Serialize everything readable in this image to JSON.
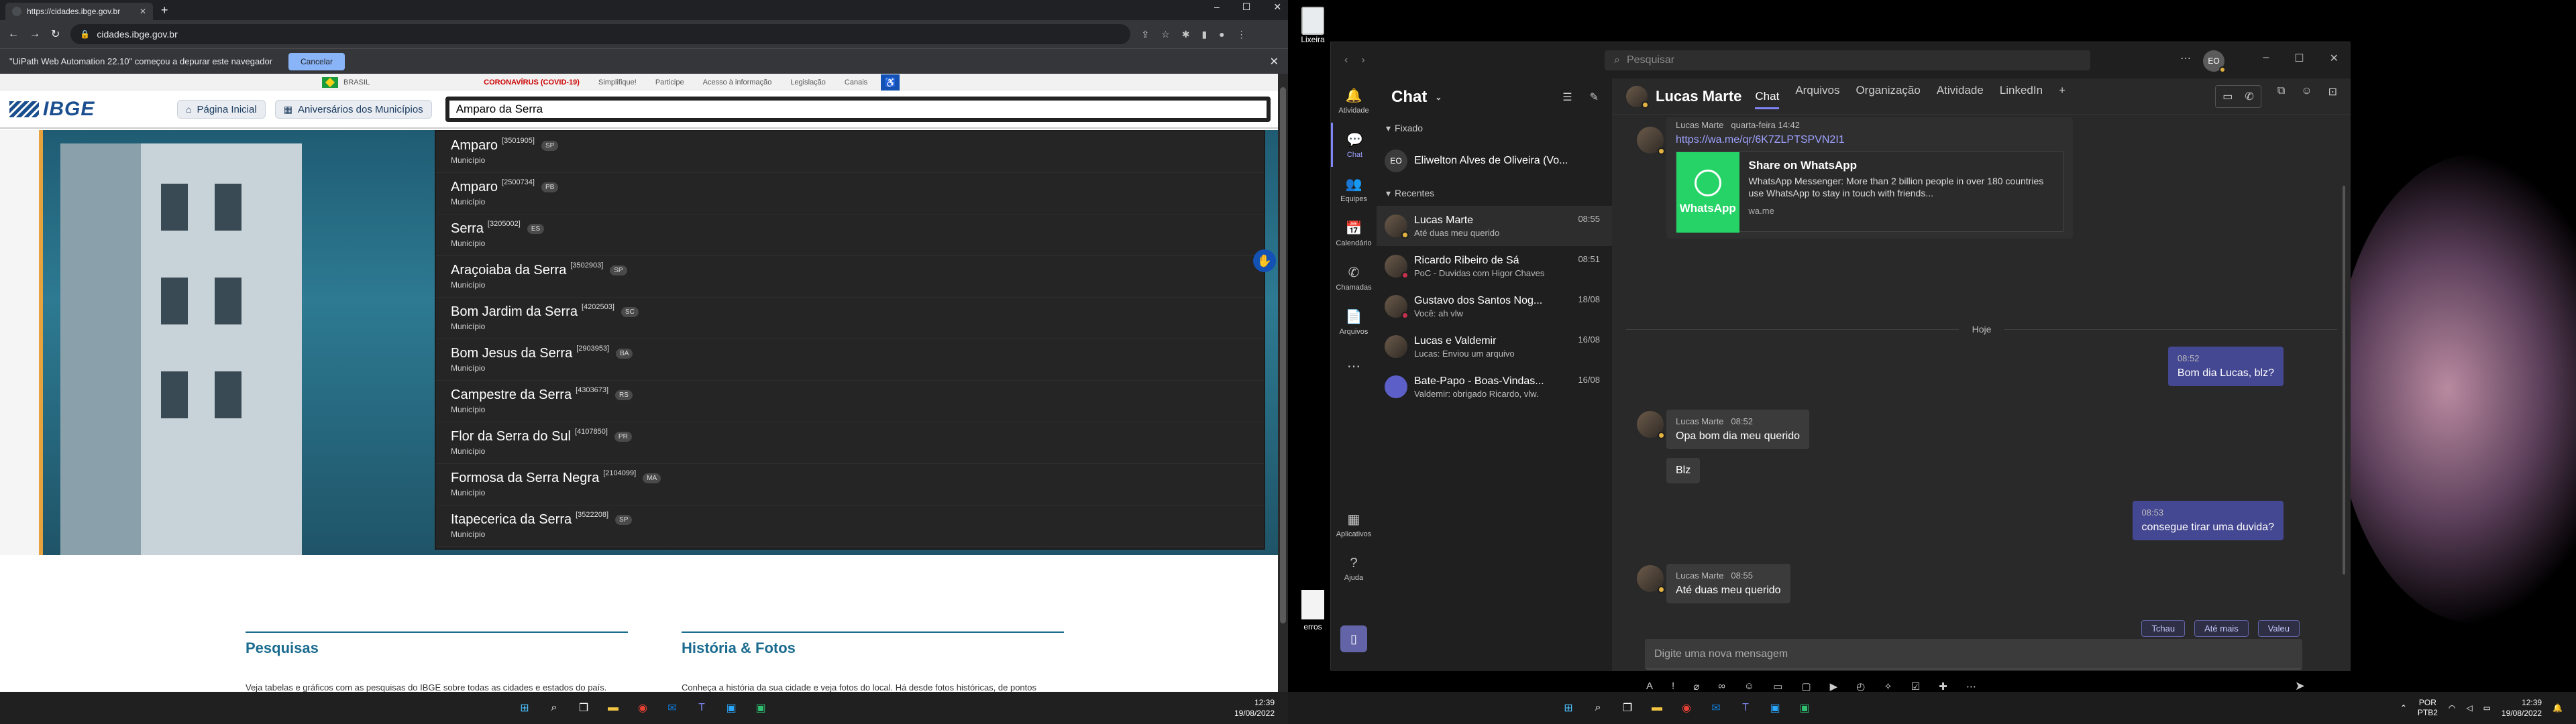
{
  "left": {
    "tab": {
      "title": "https://cidades.ibge.gov.br"
    },
    "address": "cidades.ibge.gov.br",
    "debug_bar": {
      "message": "\"UiPath Web Automation 22.10\" começou a depurar este navegador",
      "cancel": "Cancelar"
    },
    "gov_bar": {
      "brasil": "BRASIL",
      "links": [
        "CORONAVÍRUS (COVID-19)",
        "Simplifique!",
        "Participe",
        "Acesso à informação",
        "Legislação",
        "Canais"
      ]
    },
    "header": {
      "logo": "IBGE",
      "home": "Página Inicial",
      "aniversarios": "Aniversários dos Municípios",
      "search_value": "Amparo da Serra"
    },
    "dropdown": [
      {
        "name": "Amparo",
        "code": "[3501905]",
        "uf": "SP",
        "type": "Município"
      },
      {
        "name": "Amparo",
        "code": "[2500734]",
        "uf": "PB",
        "type": "Município"
      },
      {
        "name": "Serra",
        "code": "[3205002]",
        "uf": "ES",
        "type": "Município"
      },
      {
        "name": "Araçoiaba da Serra",
        "code": "[3502903]",
        "uf": "SP",
        "type": "Município"
      },
      {
        "name": "Bom Jardim da Serra",
        "code": "[4202503]",
        "uf": "SC",
        "type": "Município"
      },
      {
        "name": "Bom Jesus da Serra",
        "code": "[2903953]",
        "uf": "BA",
        "type": "Município"
      },
      {
        "name": "Campestre da Serra",
        "code": "[4303673]",
        "uf": "RS",
        "type": "Município"
      },
      {
        "name": "Flor da Serra do Sul",
        "code": "[4107850]",
        "uf": "PR",
        "type": "Município"
      },
      {
        "name": "Formosa da Serra Negra",
        "code": "[2104099]",
        "uf": "MA",
        "type": "Município"
      },
      {
        "name": "Itapecerica da Serra",
        "code": "[3522208]",
        "uf": "SP",
        "type": "Município"
      }
    ],
    "sections": {
      "pesquisas": {
        "title": "Pesquisas",
        "text": "Veja tabelas e gráficos com as pesquisas do IBGE sobre todas as cidades e estados do país. Além disso você pode comparar municípios, ver rankings e séries históricas sobre diversos temas, como trabalho, educação, gênero, saúde, entre outros. Você pode encontrar dados do PIB, IPCA, IDH, Censo e de diversas outras pesquisas."
      },
      "historia": {
        "title": "História & Fotos",
        "text": "Conheça a história da sua cidade e veja fotos do local. Há desde fotos históricas, de pontos turísticos e até mesmo de locais menos conhecidos dos municípios. Os fotos disponíveis pertencem ao Acervo Fotográfico da biblioteca do IBGE."
      }
    },
    "clock": {
      "time": "12:39",
      "date": "19/08/2022"
    }
  },
  "right": {
    "desktop": {
      "recycle": "Lixeira",
      "erros": "erros"
    },
    "teams": {
      "search_placeholder": "Pesquisar",
      "avatar": "EO",
      "rail": [
        "Atividade",
        "Chat",
        "Equipes",
        "Calendário",
        "Chamadas",
        "Arquivos",
        "...",
        "Aplicativos",
        "Ajuda"
      ],
      "chat_title": "Chat",
      "groups": {
        "pinned": "Fixado",
        "recent": "Recentes"
      },
      "pinned": [
        {
          "initials": "EO",
          "name": "Eliwelton Alves de Oliveira (Vo..."
        }
      ],
      "chats": [
        {
          "name": "Lucas Marte",
          "preview": "Até duas meu querido",
          "time": "08:55"
        },
        {
          "name": "Ricardo Ribeiro de Sá",
          "preview": "PoC - Duvidas com Higor Chaves",
          "time": "08:51"
        },
        {
          "name": "Gustavo dos Santos Nog...",
          "preview": "Você: ah vlw",
          "time": "18/08"
        },
        {
          "name": "Lucas e Valdemir",
          "preview": "Lucas: Enviou um arquivo",
          "time": "16/08"
        },
        {
          "name": "Bate-Papo - Boas-Vindas...",
          "preview": "Valdemir: obrigado Ricardo, vlw.",
          "time": "16/08"
        }
      ],
      "conversation": {
        "name": "Lucas Marte",
        "tabs": [
          "Chat",
          "Arquivos",
          "Organização",
          "Atividade",
          "LinkedIn",
          "+"
        ],
        "first": {
          "author": "Lucas Marte",
          "time": "quarta-feira 14:42",
          "link": "https://wa.me/qr/6K7ZLPTSPVN2I1"
        },
        "card": {
          "logo": "WhatsApp",
          "title": "Share on WhatsApp",
          "desc": "WhatsApp Messenger: More than 2 billion people in over 180 countries use WhatsApp to stay in touch with friends...",
          "url": "wa.me"
        },
        "divider": "Hoje",
        "m1": {
          "time": "08:52",
          "text": "Bom dia Lucas, blz?"
        },
        "m2": {
          "author": "Lucas Marte",
          "time": "08:52",
          "text": "Opa bom dia meu querido"
        },
        "m3": {
          "text": "Blz"
        },
        "m4": {
          "time": "08:53",
          "text": "consegue tirar uma duvida?"
        },
        "m5": {
          "author": "Lucas Marte",
          "time": "08:55",
          "text": "Até duas meu querido"
        },
        "quick": [
          "Tchau",
          "Até mais",
          "Valeu"
        ],
        "compose": "Digite uma nova mensagem"
      }
    },
    "tray": {
      "lang1": "POR",
      "lang2": "PTB2",
      "time": "12:39",
      "date": "19/08/2022"
    }
  }
}
